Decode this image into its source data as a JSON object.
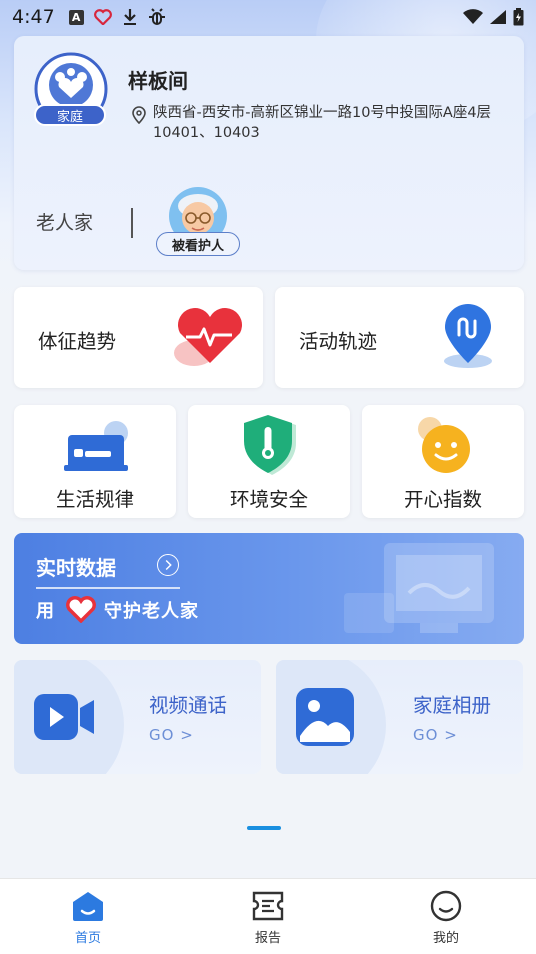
{
  "status_bar": {
    "time": "4:47",
    "icons_left": [
      "notification-a-icon",
      "heart-icon",
      "download-icon",
      "bug-icon"
    ],
    "icons_right": [
      "wifi-icon",
      "signal-icon",
      "battery-icon"
    ]
  },
  "family_card": {
    "badge": "家庭",
    "room_name": "样板间",
    "address": "陕西省-西安市-高新区锦业一路10号中投国际A座4层10401、10403",
    "elder_label": "老人家",
    "elder_tag": "被看护人"
  },
  "features": {
    "vital_trend": "体征趋势",
    "activity_track": "活动轨迹",
    "life_pattern": "生活规律",
    "environment_safety": "环境安全",
    "happiness_index": "开心指数"
  },
  "realtime": {
    "title": "实时数据",
    "slogan_pre": "用",
    "slogan_post": "守护老人家"
  },
  "video_call": {
    "title": "视频通话",
    "go": "GO >"
  },
  "family_album": {
    "title": "家庭相册",
    "go": "GO >"
  },
  "bottom_nav": {
    "home": "首页",
    "report": "报告",
    "mine": "我的"
  },
  "colors": {
    "primary_blue": "#3d63c9",
    "nav_active": "#2c7ae0",
    "heart_red": "#e8323c",
    "shield_green": "#1fae7a",
    "smile_yellow": "#f6b21f"
  }
}
